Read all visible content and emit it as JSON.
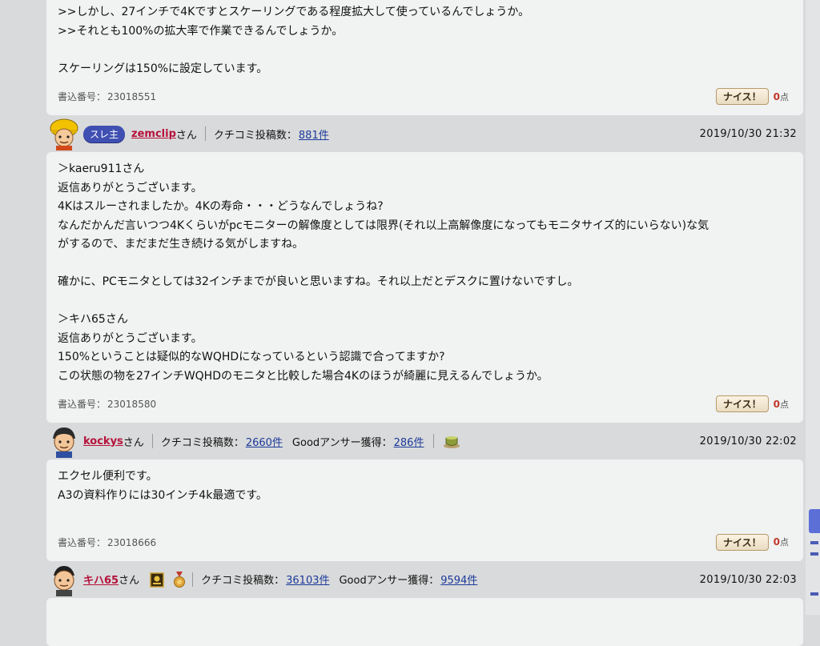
{
  "posts": [
    {
      "body_lines": [
        ">>しかし、27インチで4Kですとスケーリングである程度拡大して使っているんでしょうか。",
        ">>それとも100%の拡大率で作業できるんでしょうか。",
        "",
        "スケーリングは150%に設定しています。"
      ],
      "number_label": "書込番号：",
      "number": "23018551",
      "nice_label": "ナイス！",
      "nice_count": "0",
      "nice_unit": "点"
    },
    {
      "author": "zemclip",
      "honorific": "さん",
      "badge": "スレ主",
      "review_label": "クチコミ投稿数：",
      "review_count": "881件",
      "date": "2019/10/30 21:32",
      "body_lines": [
        "＞kaeru911さん",
        "返信ありがとうございます。",
        "4Kはスルーされましたか。4Kの寿命・・・どうなんでしょうね?",
        "なんだかんだ言いつつ4Kくらいがpcモニターの解像度としては限界(それ以上高解像度になってもモニタサイズ的にいらない)な気",
        "がするので、まだまだ生き続ける気がしますね。",
        "",
        "確かに、PCモニタとしては32インチまでが良いと思いますね。それ以上だとデスクに置けないですし。",
        "",
        "＞キハ65さん",
        "返信ありがとうございます。",
        "150%ということは疑似的なWQHDになっているという認識で合ってますか?",
        "この状態の物を27インチWQHDのモニタと比較した場合4Kのほうが綺麗に見えるんでしょうか。"
      ],
      "number_label": "書込番号：",
      "number": "23018580",
      "nice_label": "ナイス！",
      "nice_count": "0",
      "nice_unit": "点"
    },
    {
      "author": "kockys",
      "honorific": "さん",
      "review_label": "クチコミ投稿数：",
      "review_count": "2660件",
      "good_label": "Goodアンサー獲得：",
      "good_count": "286件",
      "date": "2019/10/30 22:02",
      "body_lines": [
        "エクセル便利です。",
        "A3の資料作りには30インチ4k最適です。"
      ],
      "number_label": "書込番号：",
      "number": "23018666",
      "nice_label": "ナイス！",
      "nice_count": "0",
      "nice_unit": "点"
    },
    {
      "author": "キハ65",
      "honorific": "さん",
      "review_label": "クチコミ投稿数：",
      "review_count": "36103件",
      "good_label": "Goodアンサー獲得：",
      "good_count": "9594件",
      "date": "2019/10/30 22:03"
    }
  ],
  "colors": {
    "username": "#b5123b",
    "link": "#1b3a9a",
    "badge": "#3f4fb2",
    "nice_count": "#c0392b"
  }
}
